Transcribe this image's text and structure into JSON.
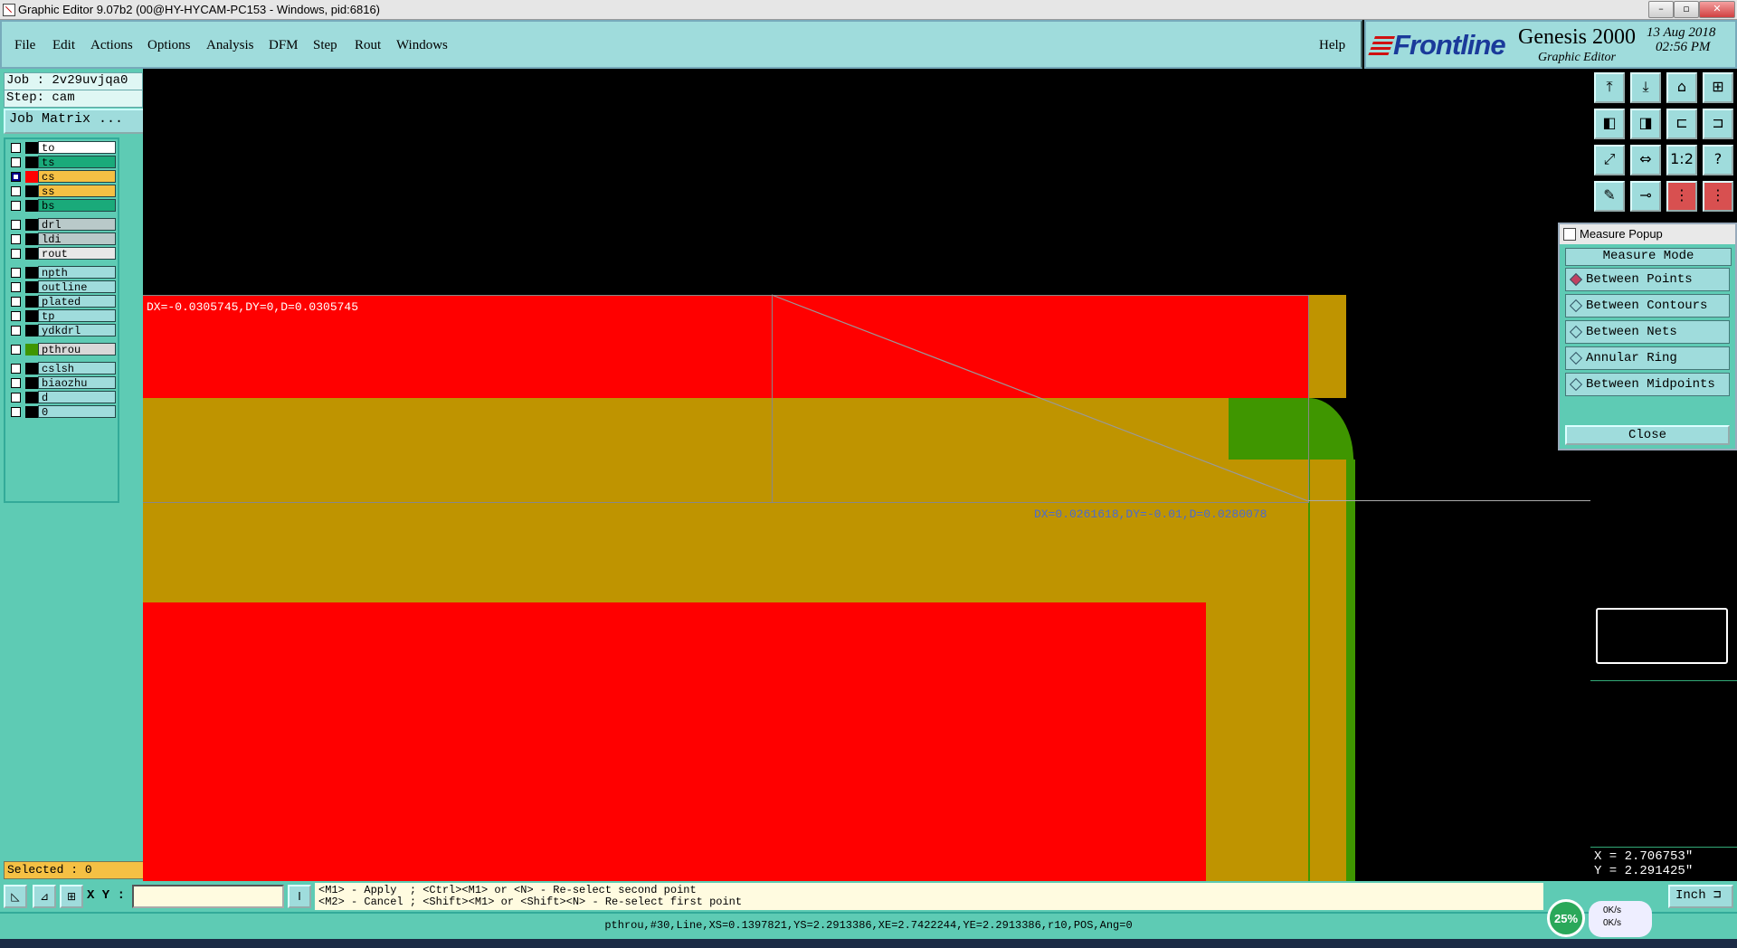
{
  "window": {
    "title": "Graphic Editor 9.07b2 (00@HY-HYCAM-PC153 - Windows, pid:6816)",
    "controls": [
      "–",
      "▫",
      "✕"
    ]
  },
  "menu": {
    "items": [
      "File",
      "Edit",
      "Actions",
      "Options",
      "Analysis",
      "DFM",
      "Step",
      "Rout",
      "Windows"
    ],
    "help": "Help"
  },
  "brand": {
    "logo": "Frontline",
    "product": "Genesis 2000",
    "subtitle": "Graphic Editor",
    "date": "13 Aug 2018",
    "time": "02:56 PM"
  },
  "job": {
    "job_line": "Job : 2v29uvjqa0",
    "step_line": "Step: cam",
    "matrix_button": "Job Matrix ..."
  },
  "layers": [
    {
      "name": "to",
      "color": "#ffffff",
      "checked": false
    },
    {
      "name": "ts",
      "color": "#1aaa7a",
      "checked": false
    },
    {
      "name": "cs",
      "color": "#f5c044",
      "checked": true
    },
    {
      "name": "ss",
      "color": "#f5c044",
      "checked": false
    },
    {
      "name": "bs",
      "color": "#1aaa7a",
      "checked": false
    },
    {
      "name": "drl",
      "color": "#b9c9c9",
      "checked": false
    },
    {
      "name": "ldi",
      "color": "#b9c9c9",
      "checked": false
    },
    {
      "name": "rout",
      "color": "#e8e8e8",
      "checked": false
    },
    {
      "name": "npth",
      "color": "#9fdcdc",
      "checked": false
    },
    {
      "name": "outline",
      "color": "#9fdcdc",
      "checked": false
    },
    {
      "name": "plated",
      "color": "#9fdcdc",
      "checked": false
    },
    {
      "name": "tp",
      "color": "#9fdcdc",
      "checked": false
    },
    {
      "name": "ydkdrl",
      "color": "#9fdcdc",
      "checked": false
    },
    {
      "name": "pthrou",
      "color": "#d8d8d8",
      "checked": false
    },
    {
      "name": "cslsh",
      "color": "#9fdcdc",
      "checked": false
    },
    {
      "name": "biaozhu",
      "color": "#9fdcdc",
      "checked": false
    },
    {
      "name": "d",
      "color": "#9fdcdc",
      "checked": false
    },
    {
      "name": "0",
      "color": "#9fdcdc",
      "checked": false
    }
  ],
  "selected": "Selected : 0",
  "canvas": {
    "measure1": "DX=-0.0305745,DY=0,D=0.0305745",
    "measure2": "DX=0.0261618,DY=-0.01,D=0.0280078"
  },
  "tools": [
    "⤒",
    "⤓",
    "⌂",
    "⊞",
    "◧",
    "◨",
    "⊏",
    "⊐",
    "⤢",
    "⇔",
    "1:2",
    "?",
    "✎",
    "⊸",
    "⋮",
    "⋮"
  ],
  "measure_popup": {
    "title": "Measure Popup",
    "mode_label": "Measure Mode",
    "options": [
      {
        "label": "Between Points",
        "selected": true
      },
      {
        "label": "Between Contours",
        "selected": false
      },
      {
        "label": "Between Nets",
        "selected": false
      },
      {
        "label": "Annular Ring",
        "selected": false
      },
      {
        "label": "Between Midpoints",
        "selected": false
      }
    ],
    "close": "Close"
  },
  "coords": {
    "x": "X = 2.706753\"",
    "y": "Y = 2.291425\""
  },
  "bottom": {
    "xy_label": "X Y :",
    "xy_value": "",
    "hint1": "<M1> - Apply  ; <Ctrl><M1> or <N> - Re-select second point",
    "hint2": "<M2> - Cancel ; <Shift><M1> or <Shift><N> - Re-select first point",
    "unit": "Inch"
  },
  "status": "pthrou,#30,Line,XS=0.1397821,YS=2.2913386,XE=2.7422244,YE=2.2913386,r10,POS,Ang=0",
  "overlay": {
    "zoom": "25%",
    "up": "0K/s",
    "down": "0K/s"
  },
  "colors": {
    "red": "#ff0000",
    "gold": "#bf9400",
    "green": "#3f9600",
    "panel": "#5ecbb4",
    "bar": "#9fdcdc"
  }
}
